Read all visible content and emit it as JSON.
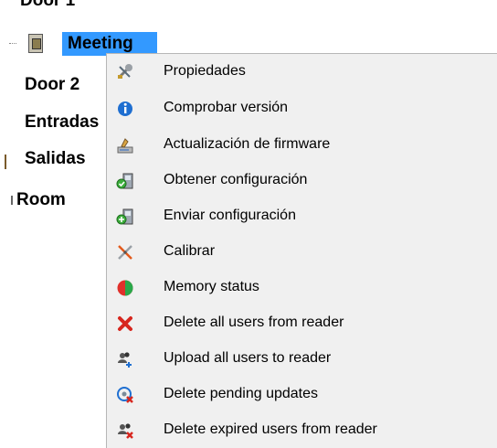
{
  "tree": {
    "cut_label": "Door 1",
    "selected_label": "Meeting",
    "items": [
      "Door 2",
      "Entradas",
      "Salidas",
      "Room"
    ]
  },
  "context_menu": {
    "items": [
      {
        "label": "Propiedades",
        "icon": "properties-tools-icon"
      },
      {
        "label": "Comprobar versión",
        "icon": "info-icon"
      },
      {
        "label": "Actualización de firmware",
        "icon": "firmware-update-icon"
      },
      {
        "label": "Obtener configuración",
        "icon": "get-config-icon"
      },
      {
        "label": "Enviar configuración",
        "icon": "send-config-icon"
      },
      {
        "label": "Calibrar",
        "icon": "calibrate-icon"
      },
      {
        "label": "Memory status",
        "icon": "memory-status-icon"
      },
      {
        "label": "Delete all users from reader",
        "icon": "delete-red-x-icon"
      },
      {
        "label": "Upload all users to reader",
        "icon": "upload-users-icon"
      },
      {
        "label": "Delete pending updates",
        "icon": "delete-pending-icon"
      },
      {
        "label": "Delete expired users from reader",
        "icon": "delete-expired-users-icon"
      }
    ]
  },
  "colors": {
    "selection": "#3399ff",
    "menu_background": "#f0f0f0",
    "info_blue": "#1f6fd1",
    "memory_red": "#e0302b",
    "memory_green": "#2aa84a",
    "delete_red": "#d7261e"
  }
}
